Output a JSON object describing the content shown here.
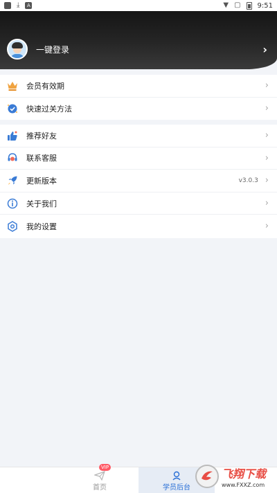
{
  "status_bar": {
    "time": "9:51",
    "icons": [
      "notification-square-icon",
      "download-icon",
      "a-icon",
      "wifi-icon",
      "no-sim-icon",
      "battery-icon"
    ]
  },
  "header": {
    "login_label": "一键登录"
  },
  "menu_group_1": [
    {
      "label": "会员有效期",
      "icon": "crown-icon"
    },
    {
      "label": "快速过关方法",
      "icon": "checklist-icon"
    }
  ],
  "menu_group_2": [
    {
      "label": "推荐好友",
      "icon": "thumbs-up-icon"
    },
    {
      "label": "联系客服",
      "icon": "customer-service-icon"
    },
    {
      "label": "更新版本",
      "icon": "rocket-icon",
      "version": "v3.0.3"
    },
    {
      "label": "关于我们",
      "icon": "info-icon"
    },
    {
      "label": "我的设置",
      "icon": "settings-icon"
    }
  ],
  "tabbar": {
    "home_label": "首页",
    "home_badge": "VIP",
    "student_label": "学员后台"
  },
  "watermark": {
    "main": "飞翔下载",
    "sub": "www.FXXZ.com"
  },
  "colors": {
    "accent": "#2a6fd6",
    "header_bg": "#1a1a1a",
    "crown": "#f0a340",
    "badge": "#ff5a66",
    "rocket": "#3a7bd5"
  }
}
